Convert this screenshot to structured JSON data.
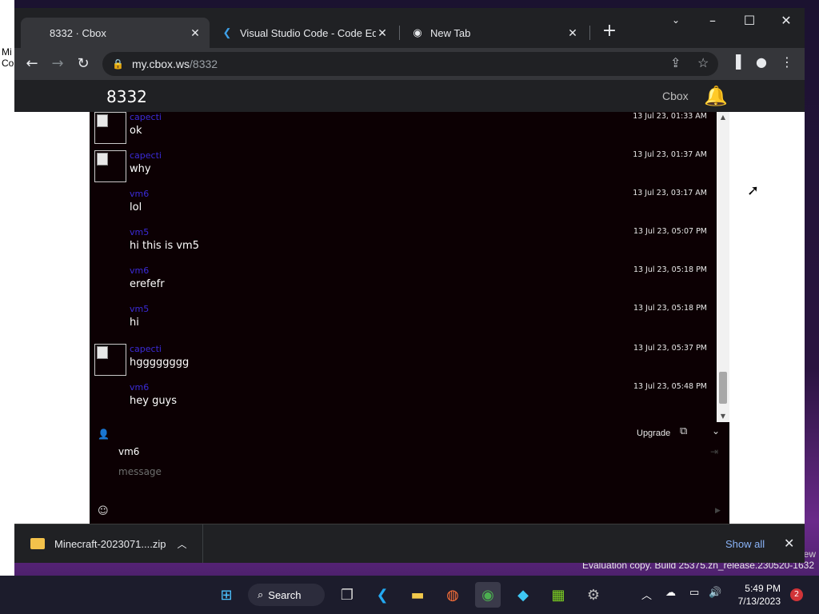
{
  "desktop": {
    "left_text_1": "Mi",
    "left_text_2": "Co",
    "right_text": "ew",
    "watermark": "Evaluation copy. Build 25375.zn_release.230520-1632"
  },
  "browser": {
    "tabs": [
      {
        "title": "8332 · Cbox",
        "icon": "cbox-favicon",
        "active": true
      },
      {
        "title": "Visual Studio Code - Code Editing",
        "icon": "vscode-icon",
        "active": false
      },
      {
        "title": "New Tab",
        "icon": "chrome-icon",
        "active": false
      }
    ],
    "url_host": "my.cbox.ws",
    "url_path": "/8332"
  },
  "cbox": {
    "title": "8332",
    "brand": "Cbox",
    "messages": [
      {
        "user": "capecti",
        "text": "ok",
        "time": "13 Jul 23, 01:33 AM",
        "avatar": true
      },
      {
        "user": "capecti",
        "text": "why",
        "time": "13 Jul 23, 01:37 AM",
        "avatar": true
      },
      {
        "user": "vm6",
        "text": "lol",
        "time": "13 Jul 23, 03:17 AM",
        "avatar": false
      },
      {
        "user": "vm5",
        "text": "hi this is vm5",
        "time": "13 Jul 23, 05:07 PM",
        "avatar": false
      },
      {
        "user": "vm6",
        "text": "erefefr",
        "time": "13 Jul 23, 05:18 PM",
        "avatar": false
      },
      {
        "user": "vm5",
        "text": "hi",
        "time": "13 Jul 23, 05:18 PM",
        "avatar": false
      },
      {
        "user": "capecti",
        "text": "hgggggggg",
        "time": "13 Jul 23, 05:37 PM",
        "avatar": true
      },
      {
        "user": "vm6",
        "text": "hey guys",
        "time": "13 Jul 23, 05:48 PM",
        "avatar": false
      }
    ],
    "upgrade_label": "Upgrade",
    "name_value": "vm6",
    "message_placeholder": "message"
  },
  "downloads": {
    "file_name": "Minecraft-2023071....zip",
    "show_all": "Show all"
  },
  "taskbar": {
    "search_label": "Search",
    "time": "5:49 PM",
    "date": "7/13/2023",
    "notification_count": "2"
  }
}
